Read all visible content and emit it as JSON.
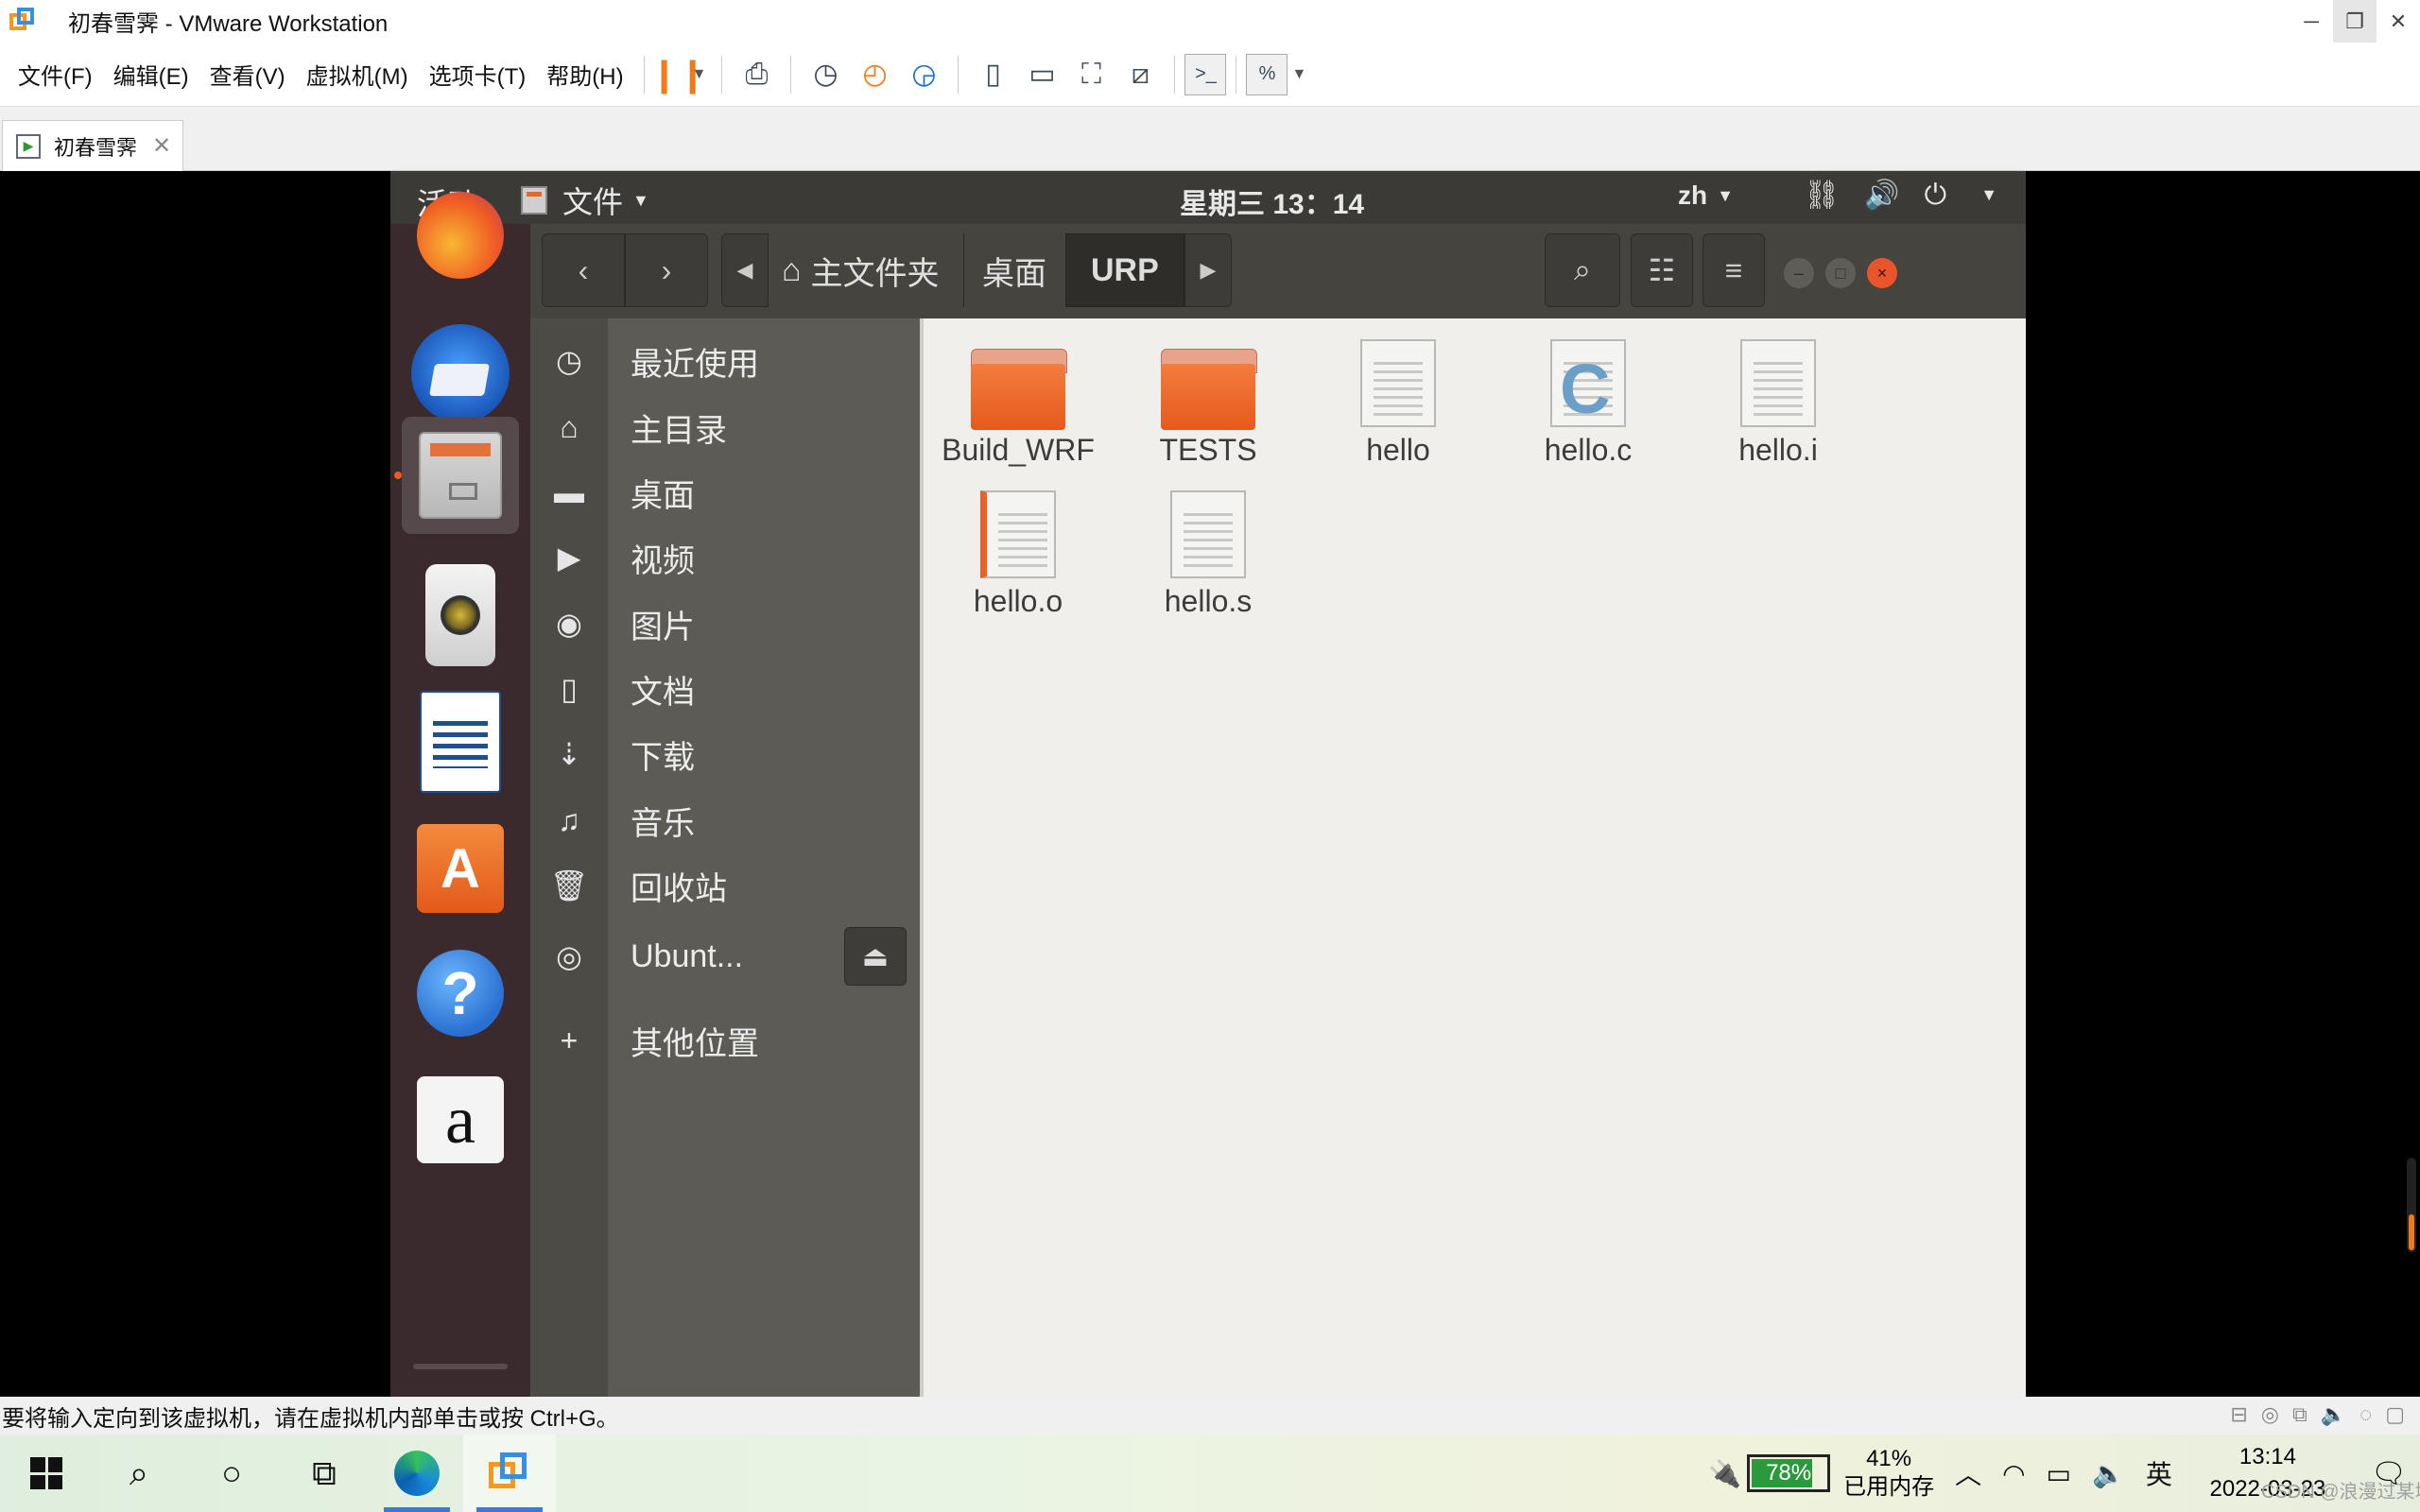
{
  "window": {
    "title": "初春雪霁 - VMware Workstation",
    "controls": {
      "minimize": "─",
      "restore": "❐",
      "close": "✕"
    }
  },
  "menubar": {
    "items": [
      "文件(F)",
      "编辑(E)",
      "查看(V)",
      "虚拟机(M)",
      "选项卡(T)",
      "帮助(H)"
    ]
  },
  "toolbar": {
    "icons": [
      "pause-icon",
      "send-ctrl-alt-del-icon",
      "snapshot-icon",
      "revert-snapshot-icon",
      "snapshot-manager-icon",
      "sidebar-view-icon",
      "thumbnail-view-icon",
      "fullscreen-icon",
      "unity-icon",
      "console-icon",
      "stretch-icon"
    ]
  },
  "tab": {
    "label": "初春雪霁",
    "close": "✕"
  },
  "guest": {
    "topbar": {
      "activities": "活动",
      "app_menu": "文件",
      "clock": "星期三 13：14",
      "lang": "zh"
    },
    "dock": {
      "apps": [
        "firefox-icon",
        "thunderbird-icon",
        "files-icon",
        "rhythmbox-icon",
        "libreoffice-writer-icon",
        "software-center-icon",
        "help-icon",
        "amazon-icon",
        "show-apps-icon"
      ],
      "help_glyph": "?",
      "amazon_glyph": "a",
      "store_glyph": "A"
    },
    "nautilus": {
      "breadcrumbs": [
        "主文件夹",
        "桌面",
        "URP"
      ],
      "sidebar": [
        {
          "icon": "recent-icon",
          "label": "最近使用"
        },
        {
          "icon": "home-icon",
          "label": "主目录"
        },
        {
          "icon": "folder-icon",
          "label": "桌面"
        },
        {
          "icon": "video-icon",
          "label": "视频"
        },
        {
          "icon": "camera-icon",
          "label": "图片"
        },
        {
          "icon": "document-icon",
          "label": "文档"
        },
        {
          "icon": "download-icon",
          "label": "下载"
        },
        {
          "icon": "music-icon",
          "label": "音乐"
        },
        {
          "icon": "trash-icon",
          "label": "回收站"
        },
        {
          "icon": "disc-icon",
          "label": "Ubunt..."
        },
        {
          "icon": "plus-icon",
          "label": "其他位置"
        }
      ],
      "files": [
        {
          "name": "Build_WRF",
          "type": "folder"
        },
        {
          "name": "TESTS",
          "type": "folder"
        },
        {
          "name": "hello",
          "type": "text"
        },
        {
          "name": "hello.c",
          "type": "c-source"
        },
        {
          "name": "hello.i",
          "type": "text"
        },
        {
          "name": "hello.o",
          "type": "object"
        },
        {
          "name": "hello.s",
          "type": "text"
        }
      ],
      "c_glyph": "C"
    }
  },
  "statusbar": {
    "text": "要将输入定向到该虚拟机，请在虚拟机内部单击或按 Ctrl+G。"
  },
  "taskbar": {
    "battery": "78%",
    "memory_pct": "41%",
    "memory_label": "已用内存",
    "ime": "英",
    "time": "13:14",
    "date": "2022-03-23",
    "watermark": "CSDN @浪漫过某城"
  },
  "colors": {
    "accent": "#f07b16",
    "ubuntu_orange": "#e95420",
    "dock_bg": "#3a2a2e",
    "header_bg": "#45443f"
  }
}
